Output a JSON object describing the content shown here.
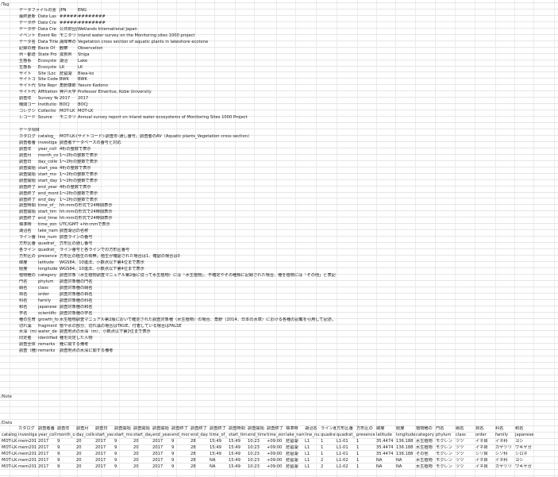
{
  "sheet_markers": {
    "top": "/Tag",
    "mid": "/Note",
    "low": "/Data"
  },
  "meta_rows": [
    [
      "データファイルの言",
      "JPN",
      "ENG"
    ],
    [
      "最終更新",
      "Date Las",
      "########",
      "########"
    ],
    [
      "データ作",
      "Date Cre",
      "########",
      "########"
    ],
    [
      "データ作",
      "Data Cre",
      "公共財団法",
      "Wetlands International Japan"
    ],
    [
      "イベント",
      "Event Ro",
      "モニタリ",
      "Inland water survey on the Monitoring sites 1000 project"
    ],
    [
      "データ名",
      "Data Title",
      "湖岸帯の",
      "Vegetation cross section of aquatic plants in lakeshore ecotone"
    ],
    [
      "記録の種",
      "Basis Of",
      "観察",
      "Observation"
    ],
    [
      "州・都道",
      "State Pro",
      "滋賀県",
      "Shiga"
    ],
    [
      "生態系",
      "Ecosyste",
      "湖沼",
      "Lake"
    ],
    [
      "生態系",
      "Ecosyste",
      "LK",
      "LK"
    ],
    [
      "サイト",
      "Site (Loc",
      "琵琶湖",
      "Biwa-ko"
    ],
    [
      "サイトコ",
      "Site Code",
      "BWK",
      "BWK"
    ],
    [
      "サイト代",
      "Site Repr",
      "角野康郎",
      "Yasuro Kadono"
    ],
    [
      "サイト代",
      "Affiliation",
      "神戸大学",
      "Professor Emeritus, Kobe University"
    ],
    [
      "調査年",
      "Survey Ye",
      "2017",
      "2017"
    ],
    [
      "機関コー",
      "Institutio",
      "BOCJ",
      "BOCJ"
    ],
    [
      "コレクシ",
      "Collectio",
      "MOT-LK",
      "MOT-LK"
    ],
    [
      "レコード",
      "Source",
      "モニタリ",
      "Annual survey report on inland water ecosystems of Monitoring Sites 1000 Project"
    ]
  ],
  "glossary_title": "データ項目",
  "glossary_rows": [
    [
      "カタログ",
      "catalog_",
      "MOT-LK-(サイトコード)-調査年-通し番号。調査者のAV（Aquatic plants_Vegetation cross section）"
    ],
    [
      "調査者番",
      "investiga",
      "調査者データベースの番号と対応"
    ],
    [
      "調査年",
      "year_coll",
      "4桁の整数で表示"
    ],
    [
      "調査月",
      "month_co",
      "1～2桁の整数で表示"
    ],
    [
      "調査日",
      "day_colle",
      "1～2桁の整数で表示"
    ],
    [
      "調査開始",
      "start_yea",
      "4桁の整数で表示"
    ],
    [
      "調査開始",
      "start_mo",
      "1～2桁の整数で表示"
    ],
    [
      "調査開始",
      "start_day",
      "1～2桁の整数で表示"
    ],
    [
      "調査終了",
      "end_year",
      "4桁の整数で表示"
    ],
    [
      "調査終了",
      "end_mont",
      "1～2桁の整数で表示"
    ],
    [
      "調査終了",
      "end_day",
      "1～2桁の整数で表示"
    ],
    [
      "調査時間",
      "time_of_",
      "hh:mmの形式で24時間表示"
    ],
    [
      "調査開始",
      "start_tim",
      "hh:mmの形式で24時間表示"
    ],
    [
      "調査終了",
      "end_time",
      "hh:mmの形式で24時間表示"
    ],
    [
      "標準時",
      "time_zon",
      "UTC/GMT +hh:mmで表示"
    ],
    [
      "湖沼名",
      "lake_nam",
      "調査湖沼の名称"
    ],
    [
      "ライン番",
      "line_num",
      "調査ラインの番号"
    ],
    [
      "方形区番",
      "quadrat_",
      "方形区の通し番号"
    ],
    [
      "各ライン",
      "quadrat_",
      "ライン番号と各ラインでの方形区番号"
    ],
    [
      "方形区の",
      "presence",
      "方形区の植生の有無。植生が確認された場合は1、確認の場合は0"
    ],
    [
      "緯度",
      "latitude",
      "WGS84、10進法、小数点以下第4位まで表示"
    ],
    [
      "経度",
      "longitude",
      "WGS84、10進法、小数点以下第4位まで表示"
    ],
    [
      "植物種の",
      "category",
      "調査対象（水生植物調査マニュアル第2版に従って水生植物）には「水生植物」、不確定やその種類に記録された場合、種を植物には「その他」と表記"
    ],
    [
      "門名",
      "phylum",
      "調査対象種の門名"
    ],
    [
      "綱名",
      "class",
      "調査対象種の綱名"
    ],
    [
      "目名",
      "order",
      "調査対象種の目名"
    ],
    [
      "科名",
      "family",
      "調査対象種の科名"
    ],
    [
      "和名",
      "japanese",
      "調査対象種の和名"
    ],
    [
      "学名",
      "scientific",
      "調査対象種の学名"
    ],
    [
      "種の生育",
      "growth_fo",
      "水生植物調査マニュアル第2版において確定された調査対象種（水生植物）の場合、角野（2014、日本の水草）における各種の記載を引用して記述。"
    ],
    [
      "切れ藻",
      "fragment",
      "根や水の部分、切れ藻の場合はTRUE、付着している場合はFALSE"
    ],
    [
      "水深（m）",
      "water_de",
      "調査地点の水深（m）、小数点以下第2位まで表示"
    ],
    [
      "同定者",
      "identified",
      "種を同定した人物"
    ],
    [
      "調査全体",
      "remarks",
      "種に関する備考"
    ],
    [
      "調査（種）",
      "remarks",
      "調査地点の水深に関する備考"
    ]
  ],
  "data_header_jp": [
    "カタログ",
    "調査者番",
    "調査年",
    "調査月",
    "調査日",
    "調査開始",
    "調査開始",
    "調査開始",
    "調査終了",
    "調査終了",
    "調査終了",
    "調査時間",
    "調査開始",
    "調査終了",
    "標準時",
    "湖沼名",
    "ライン番",
    "方形区番",
    "方形区の",
    "緯度",
    "経度",
    "植物種の",
    "門名",
    "綱名",
    "目名",
    "科名",
    "和名"
  ],
  "data_header_en": [
    "catalog_",
    "investiga",
    "year_coll",
    "month_co",
    "day_colle",
    "start_yea",
    "start_mo",
    "start_day",
    "end_year",
    "end_mon",
    "end_day",
    "time_of_",
    "start_tim",
    "end_time",
    "time_zon",
    "lake_nam",
    "line_num",
    "quadrat_",
    "quadrat_",
    "presence",
    "latitude",
    "longitude",
    "category",
    "phylum",
    "class",
    "order",
    "family",
    "japanese"
  ],
  "data_rows": [
    [
      "MOT-LK-",
      "mem201",
      "2017",
      "9",
      "20",
      "2017",
      "9",
      "20",
      "2017",
      "9",
      "28",
      "15:49",
      "15:49",
      "10:23",
      "+09:00",
      "琵琶湖",
      "L1",
      "1",
      "L1-01",
      "1",
      "35.4474",
      "136.188",
      "水生植物",
      "モクレン",
      "ツツ",
      "イネ目",
      "イネ科",
      "ヨシ"
    ],
    [
      "MOT-LK-",
      "mem201",
      "2017",
      "9",
      "20",
      "2017",
      "9",
      "20",
      "2017",
      "9",
      "28",
      "15:49",
      "15:49",
      "10:23",
      "+09:00",
      "琵琶湖",
      "L1",
      "1",
      "L1-01",
      "1",
      "35.4474",
      "136.188",
      "水生植物",
      "モクレン",
      "ツツ",
      "イネ目",
      "カヤツリ",
      "ワキヤガ"
    ],
    [
      "MOT-LK-",
      "mem201",
      "2017",
      "9",
      "20",
      "2017",
      "9",
      "20",
      "2017",
      "9",
      "28",
      "15:49",
      "15:49",
      "10:23",
      "+09:00",
      "琵琶湖",
      "L1",
      "1",
      "L1-01",
      "1",
      "35.4474",
      "136.188",
      "その他",
      "モクレン",
      "ツツ",
      "シソ目",
      "シソ科",
      "シロネ"
    ],
    [
      "MOT-LK-",
      "mem201",
      "2017",
      "9",
      "20",
      "2017",
      "9",
      "20",
      "2017",
      "9",
      "28",
      "NA",
      "15:49",
      "10:23",
      "+09:00",
      "琵琶湖",
      "L1",
      "2",
      "L1-02",
      "1",
      "NA",
      "NA",
      "水生植物",
      "モクレン",
      "ツツ",
      "イネ目",
      "イネ科",
      "ヨシ"
    ],
    [
      "MOT-LK-",
      "mem201",
      "2017",
      "9",
      "20",
      "2017",
      "9",
      "20",
      "2017",
      "9",
      "28",
      "NA",
      "15:49",
      "10:23",
      "+09:00",
      "琵琶湖",
      "L1",
      "2",
      "L1-02",
      "1",
      "NA",
      "NA",
      "水生植物",
      "モクレン",
      "ツツ",
      "イネ目",
      "カヤツリ",
      "ワキヤガ"
    ]
  ]
}
